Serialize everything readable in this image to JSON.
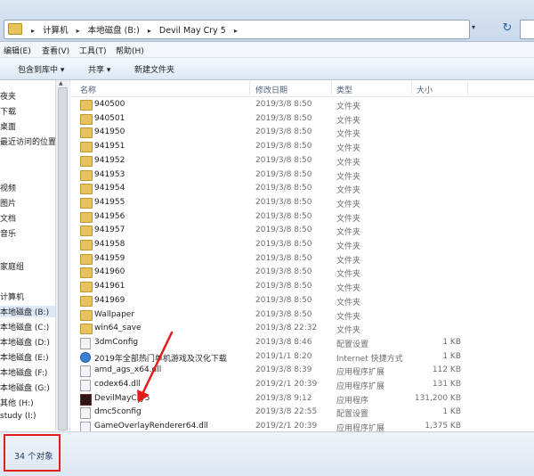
{
  "address": {
    "crumbs": [
      "计算机",
      "本地磁盘 (B:)",
      "Devil May Cry 5"
    ],
    "sep": "▸",
    "dropdown": "▾",
    "refresh": "↻"
  },
  "menu": [
    "编辑(E)",
    "查看(V)",
    "工具(T)",
    "帮助(H)"
  ],
  "toolbar": [
    "包含到库中 ▾",
    "共享 ▾",
    "新建文件夹"
  ],
  "nav": [
    "夜夹",
    "下载",
    "桌面",
    "最近访问的位置",
    "视频",
    "图片",
    "文档",
    "音乐",
    "家庭组",
    "计算机",
    "本地磁盘 (B:)",
    "本地磁盘 (C:)",
    "本地磁盘 (D:)",
    "本地磁盘 (E:)",
    "本地磁盘 (F:)",
    "本地磁盘 (G:)",
    "其他 (H:)",
    "study (I:)"
  ],
  "columns": {
    "name": "名称",
    "date": "修改日期",
    "type": "类型",
    "size": "大小"
  },
  "files": [
    {
      "name": "940500",
      "date": "2019/3/8 8:50",
      "type": "文件夹",
      "size": "",
      "icon": "folder-icon"
    },
    {
      "name": "940501",
      "date": "2019/3/8 8:50",
      "type": "文件夹",
      "size": "",
      "icon": "folder-icon"
    },
    {
      "name": "941950",
      "date": "2019/3/8 8:50",
      "type": "文件夹",
      "size": "",
      "icon": "folder-icon"
    },
    {
      "name": "941951",
      "date": "2019/3/8 8:50",
      "type": "文件夹",
      "size": "",
      "icon": "folder-icon"
    },
    {
      "name": "941952",
      "date": "2019/3/8 8:50",
      "type": "文件夹",
      "size": "",
      "icon": "folder-icon"
    },
    {
      "name": "941953",
      "date": "2019/3/8 8:50",
      "type": "文件夹",
      "size": "",
      "icon": "folder-icon"
    },
    {
      "name": "941954",
      "date": "2019/3/8 8:50",
      "type": "文件夹",
      "size": "",
      "icon": "folder-icon"
    },
    {
      "name": "941955",
      "date": "2019/3/8 8:50",
      "type": "文件夹",
      "size": "",
      "icon": "folder-icon"
    },
    {
      "name": "941956",
      "date": "2019/3/8 8:50",
      "type": "文件夹",
      "size": "",
      "icon": "folder-icon"
    },
    {
      "name": "941957",
      "date": "2019/3/8 8:50",
      "type": "文件夹",
      "size": "",
      "icon": "folder-icon"
    },
    {
      "name": "941958",
      "date": "2019/3/8 8:50",
      "type": "文件夹",
      "size": "",
      "icon": "folder-icon"
    },
    {
      "name": "941959",
      "date": "2019/3/8 8:50",
      "type": "文件夹",
      "size": "",
      "icon": "folder-icon"
    },
    {
      "name": "941960",
      "date": "2019/3/8 8:50",
      "type": "文件夹",
      "size": "",
      "icon": "folder-icon"
    },
    {
      "name": "941961",
      "date": "2019/3/8 8:50",
      "type": "文件夹",
      "size": "",
      "icon": "folder-icon"
    },
    {
      "name": "941969",
      "date": "2019/3/8 8:50",
      "type": "文件夹",
      "size": "",
      "icon": "folder-icon"
    },
    {
      "name": "Wallpaper",
      "date": "2019/3/8 8:50",
      "type": "文件夹",
      "size": "",
      "icon": "folder-icon"
    },
    {
      "name": "win64_save",
      "date": "2019/3/8 22:32",
      "type": "文件夹",
      "size": "",
      "icon": "folder-icon"
    },
    {
      "name": "3dmConfig",
      "date": "2019/3/8 8:46",
      "type": "配置设置",
      "size": "1 KB",
      "icon": "config-icon"
    },
    {
      "name": "2019年全部热门单机游戏及汉化下载",
      "date": "2019/1/1 8:20",
      "type": "Internet 快捷方式",
      "size": "1 KB",
      "icon": "url-icon"
    },
    {
      "name": "amd_ags_x64.dll",
      "date": "2019/3/8 8:39",
      "type": "应用程序扩展",
      "size": "112 KB",
      "icon": "dll-icon"
    },
    {
      "name": "codex64.dll",
      "date": "2019/2/1 20:39",
      "type": "应用程序扩展",
      "size": "131 KB",
      "icon": "dll-icon"
    },
    {
      "name": "DevilMayCry5",
      "date": "2019/3/8 9:12",
      "type": "应用程序",
      "size": "131,200 KB",
      "icon": "exe-icon"
    },
    {
      "name": "dmc5config",
      "date": "2019/3/8 22:55",
      "type": "配置设置",
      "size": "1 KB",
      "icon": "config-icon"
    },
    {
      "name": "GameOverlayRenderer64.dll",
      "date": "2019/2/1 20:39",
      "type": "应用程序扩展",
      "size": "1,375 KB",
      "icon": "dll-icon"
    }
  ],
  "status": {
    "count": "34 个对象"
  },
  "colors": {
    "folder": "#e7c45b",
    "highlight": "#e31c1c"
  }
}
